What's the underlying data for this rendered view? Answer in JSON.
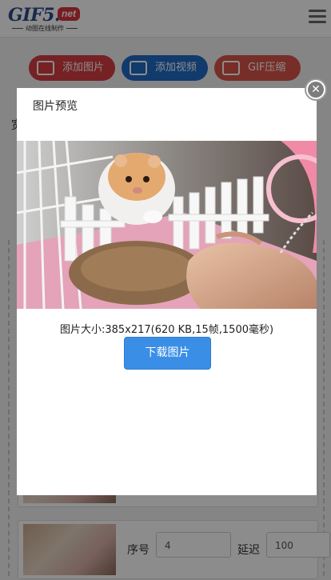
{
  "header": {
    "logo_main": "GIF5.",
    "logo_net": "net",
    "logo_sub": "动图在线制作"
  },
  "toolbar": {
    "add_image": "添加图片",
    "add_video": "添加视频",
    "gif_compress": "GIF压缩"
  },
  "background": {
    "partial_text": "宽",
    "frame": {
      "seq_label": "序号",
      "seq_value": "4",
      "delay_label": "延迟",
      "delay_value": "100"
    }
  },
  "modal": {
    "title": "图片预览",
    "size_info": "图片大小:385x217(620 KB,15帧,1500毫秒)",
    "download": "下载图片"
  }
}
